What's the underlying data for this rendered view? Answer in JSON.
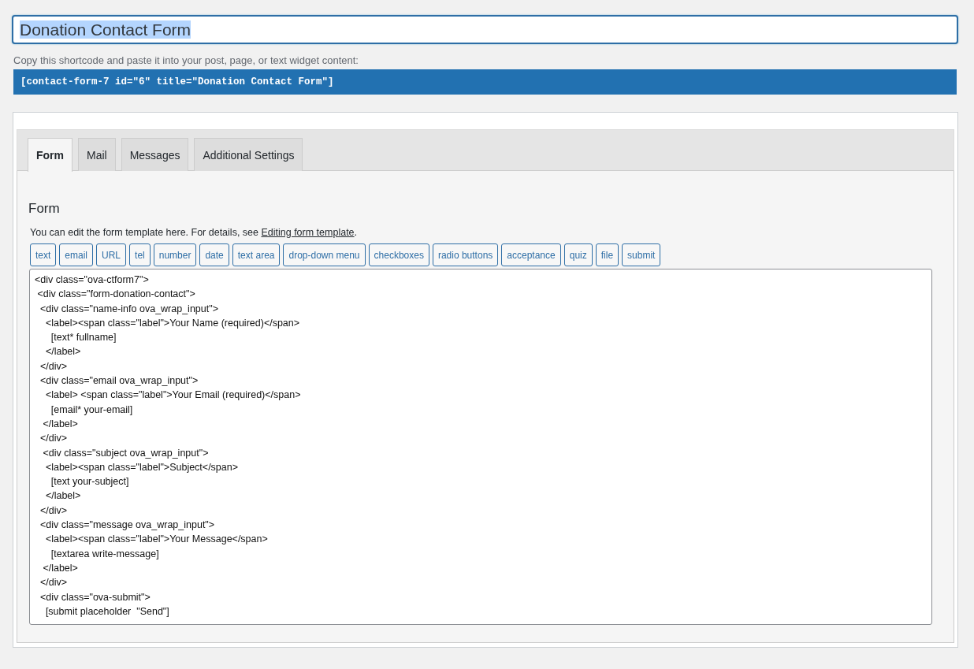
{
  "title_field": {
    "value": "Donation Contact Form",
    "text_selected": true
  },
  "shortcode_hint": "Copy this shortcode and paste it into your post, page, or text widget content:",
  "shortcode": "[contact-form-7 id=\"6\" title=\"Donation Contact Form\"]",
  "tabs": [
    {
      "label": "Form",
      "selected": true
    },
    {
      "label": "Mail",
      "selected": false
    },
    {
      "label": "Messages",
      "selected": false
    },
    {
      "label": "Additional Settings",
      "selected": false
    }
  ],
  "form_panel": {
    "heading": "Form",
    "description": "You can edit the form template here. For details, see ",
    "link": "Editing form template",
    "description_end": ".",
    "tag_buttons": [
      "text",
      "email",
      "URL",
      "tel",
      "number",
      "date",
      "text area",
      "drop-down menu",
      "checkboxes",
      "radio buttons",
      "acceptance",
      "quiz",
      "file",
      "submit"
    ],
    "template_lines": [
      "<div class=\"ova-ctform7\">",
      " <div class=\"form-donation-contact\">",
      "  <div class=\"name-info ova_wrap_input\">",
      "    <label><span class=\"label\">Your Name (required)</span>",
      "      [text* fullname]",
      "    </label>",
      "  </div>",
      "  <div class=\"email ova_wrap_input\">",
      "    <label> <span class=\"label\">Your Email (required)</span>",
      "      [email* your-email]",
      "   </label>",
      "  </div>",
      "   <div class=\"subject ova_wrap_input\">",
      "    <label><span class=\"label\">Subject</span>",
      "      [text your-subject]",
      "    </label>",
      "  </div>",
      "  <div class=\"message ova_wrap_input\">",
      "    <label><span class=\"label\">Your Message</span>",
      "      [textarea write-message]",
      "   </label>",
      "  </div>",
      "  <div class=\"ova-submit\">",
      "    [submit placeholder  \"Send\"]"
    ]
  }
}
